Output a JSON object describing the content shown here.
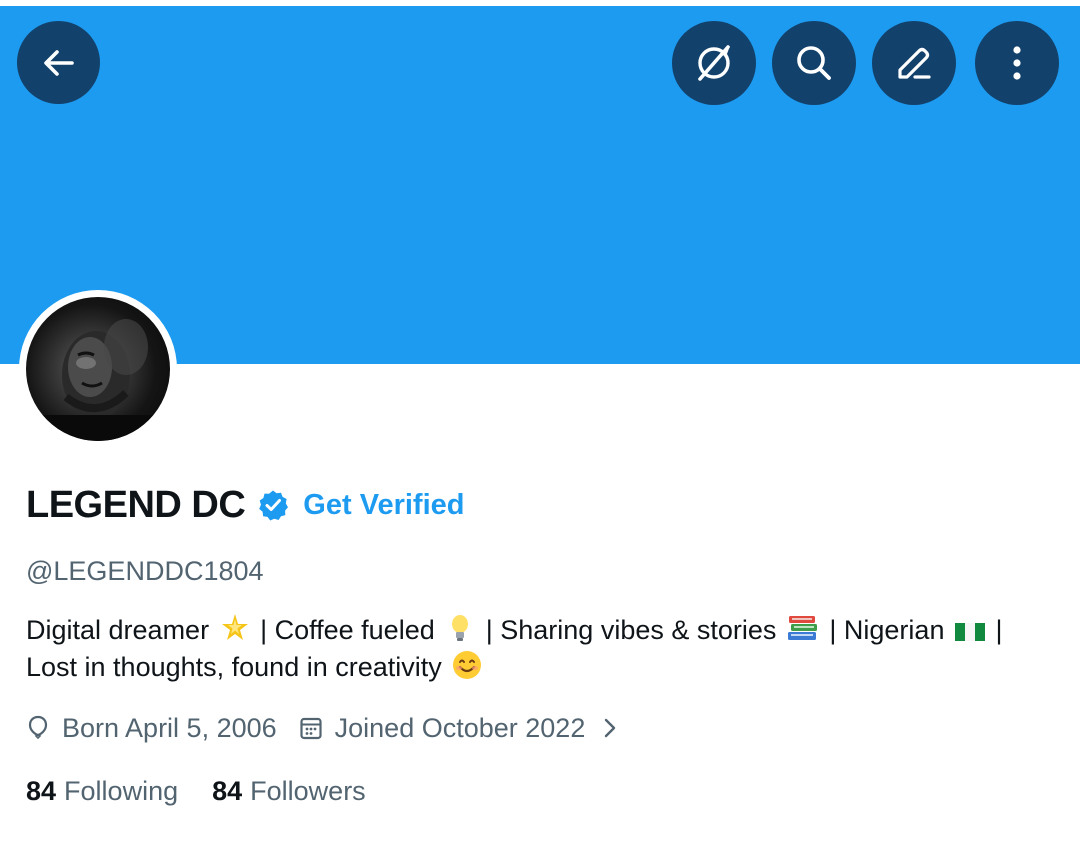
{
  "header": {
    "banner_color": "#1d9bf0",
    "actions": [
      {
        "name": "back",
        "icon": "arrow-left-icon"
      },
      {
        "name": "grok",
        "icon": "grok-icon"
      },
      {
        "name": "search",
        "icon": "search-icon"
      },
      {
        "name": "compose",
        "icon": "pencil-icon"
      },
      {
        "name": "more",
        "icon": "more-vertical-icon"
      }
    ]
  },
  "profile": {
    "display_name": "LEGEND DC",
    "verified_badge_icon": "verified-badge-icon",
    "get_verified_label": "Get Verified",
    "handle": "@LEGENDDC1804",
    "bio": {
      "part1": "Digital dreamer",
      "part2": "| Coffee fueled",
      "part3": "| Sharing vibes & stories",
      "part4": "| Nigerian",
      "part5": "|",
      "line2": "Lost in thoughts, found in creativity",
      "emojis": [
        "glowing-star-emoji",
        "light-bulb-emoji",
        "books-emoji",
        "nigeria-flag-emoji",
        "smiling-face-emoji"
      ]
    },
    "birthday": "Born April 5, 2006",
    "joined": "Joined October 2022",
    "following_count": "84",
    "following_label": "Following",
    "followers_count": "84",
    "followers_label": "Followers"
  },
  "colors": {
    "accent": "#1d9bf0",
    "text": "#0f1419",
    "secondary_text": "#536471"
  }
}
